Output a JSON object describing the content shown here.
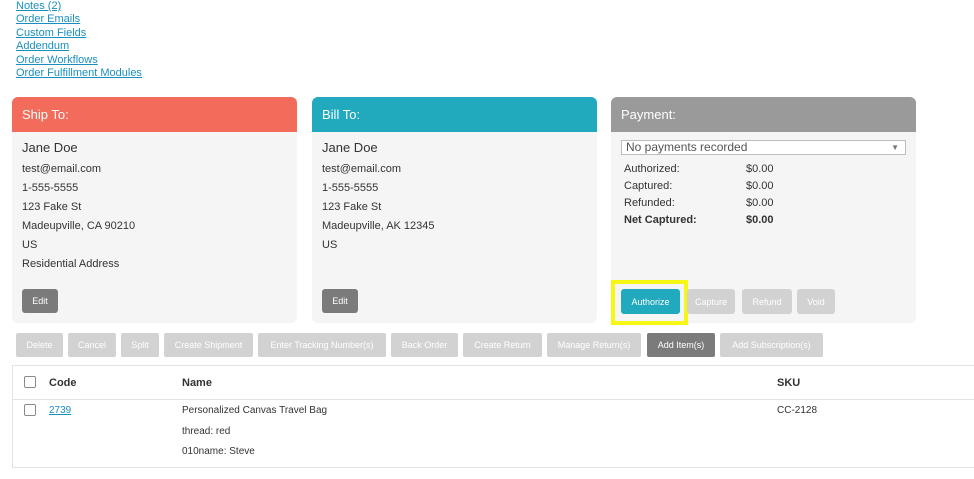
{
  "links": [
    "Notes (2)",
    "Order Emails",
    "Custom Fields",
    "Addendum",
    "Order Workflows",
    "Order Fulfillment Modules"
  ],
  "ship_to": {
    "title": "Ship To:",
    "name": "Jane Doe",
    "lines": [
      "test@email.com",
      "1-555-5555",
      "123 Fake St",
      "Madeupville, CA 90210",
      "US",
      "Residential Address"
    ],
    "edit_label": "Edit"
  },
  "bill_to": {
    "title": "Bill To:",
    "name": "Jane Doe",
    "lines": [
      "test@email.com",
      "1-555-5555",
      "123 Fake St",
      "Madeupville, AK 12345",
      "US"
    ],
    "edit_label": "Edit"
  },
  "payment": {
    "title": "Payment:",
    "select_value": "No payments recorded",
    "rows": [
      {
        "label": "Authorized:",
        "value": "$0.00"
      },
      {
        "label": "Captured:",
        "value": "$0.00"
      },
      {
        "label": "Refunded:",
        "value": "$0.00"
      },
      {
        "label": "Net Captured:",
        "value": "$0.00"
      }
    ],
    "buttons": {
      "authorize": "Authorize",
      "capture": "Capture",
      "refund": "Refund",
      "void": "Void"
    }
  },
  "actions": [
    "Delete",
    "Cancel",
    "Split",
    "Create Shipment",
    "Enter Tracking Number(s)",
    "Back Order",
    "Create Return",
    "Manage Return(s)",
    "Add Item(s)",
    "Add Subscription(s)"
  ],
  "items_table": {
    "headers": {
      "code": "Code",
      "name": "Name",
      "sku": "SKU"
    },
    "rows": [
      {
        "code": "2739",
        "name": "Personalized Canvas Travel Bag",
        "options": [
          "thread: red",
          "010name: Steve"
        ],
        "sku": "CC-2128"
      }
    ]
  },
  "colors": {
    "ship_header": "#f26b5b",
    "bill_header": "#21a9be",
    "payment_header": "#9a9a9a",
    "highlight": "#f7f716",
    "link": "#1a8fbf"
  }
}
